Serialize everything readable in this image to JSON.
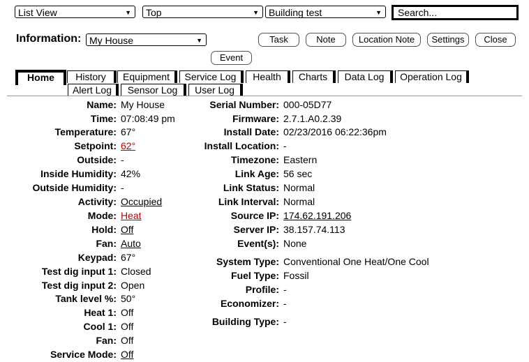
{
  "toolbar": {
    "view_select": "List View",
    "scope_select": "Top",
    "building_select": "Building test",
    "search_placeholder": "Search..."
  },
  "info": {
    "label": "Information:",
    "selected": "My House",
    "buttons": [
      "Task",
      "Note",
      "Location Note",
      "Settings",
      "Close",
      "Event"
    ]
  },
  "tabs_row1": [
    "Home",
    "History",
    "Equipment",
    "Service Log",
    "Health",
    "Charts",
    "Data Log",
    "Operation Log"
  ],
  "tabs_row2": [
    "Alert Log",
    "Sensor Log",
    "User Log"
  ],
  "left": [
    {
      "label": "Name:",
      "value": "My House"
    },
    {
      "label": "Time:",
      "value": "07:08:49 pm"
    },
    {
      "label": "Temperature:",
      "value": "67°"
    },
    {
      "label": "Setpoint:",
      "value": "62°"
    },
    {
      "label": "Outside:",
      "value": "-"
    },
    {
      "label": "Inside Humidity:",
      "value": "42%"
    },
    {
      "label": "Outside Humidity:",
      "value": "-"
    },
    {
      "label": "Activity:",
      "value": "Occupied"
    },
    {
      "label": "Mode:",
      "value": "Heat"
    },
    {
      "label": "Hold:",
      "value": "Off"
    },
    {
      "label": "Fan:",
      "value": "Auto"
    },
    {
      "label": "Keypad:",
      "value": "67°"
    },
    {
      "label": "Test dig input 1:",
      "value": "Closed"
    },
    {
      "label": "Test dig input 2:",
      "value": "Open"
    },
    {
      "label": "Tank level %:",
      "value": "50°"
    },
    {
      "label": "Heat 1:",
      "value": "Off"
    },
    {
      "label": "Cool 1:",
      "value": "Off"
    },
    {
      "label": "Fan:",
      "value": "Off"
    },
    {
      "label": "Service Mode:",
      "value": "Off"
    }
  ],
  "right": [
    {
      "label": "Serial Number:",
      "value": "000-05D77"
    },
    {
      "label": "Firmware:",
      "value": "2.7.1.A0.2.39"
    },
    {
      "label": "Install Date:",
      "value": "02/23/2016 06:22:36pm"
    },
    {
      "label": "Install Location:",
      "value": "-"
    },
    {
      "label": "Timezone:",
      "value": "Eastern"
    },
    {
      "label": "Link Age:",
      "value": "56 sec"
    },
    {
      "label": "Link Status:",
      "value": "Normal"
    },
    {
      "label": "Link Interval:",
      "value": "Normal"
    },
    {
      "label": "Source IP:",
      "value": "174.62.191.206"
    },
    {
      "label": "Server IP:",
      "value": "38.157.74.113"
    },
    {
      "label": "Event(s):",
      "value": "None"
    },
    {
      "label": "System Type:",
      "value": "Conventional One Heat/One Cool"
    },
    {
      "label": "Fuel Type:",
      "value": "Fossil"
    },
    {
      "label": "Profile:",
      "value": "-"
    },
    {
      "label": "Economizer:",
      "value": "-"
    },
    {
      "label": "Building Type:",
      "value": "-"
    }
  ]
}
